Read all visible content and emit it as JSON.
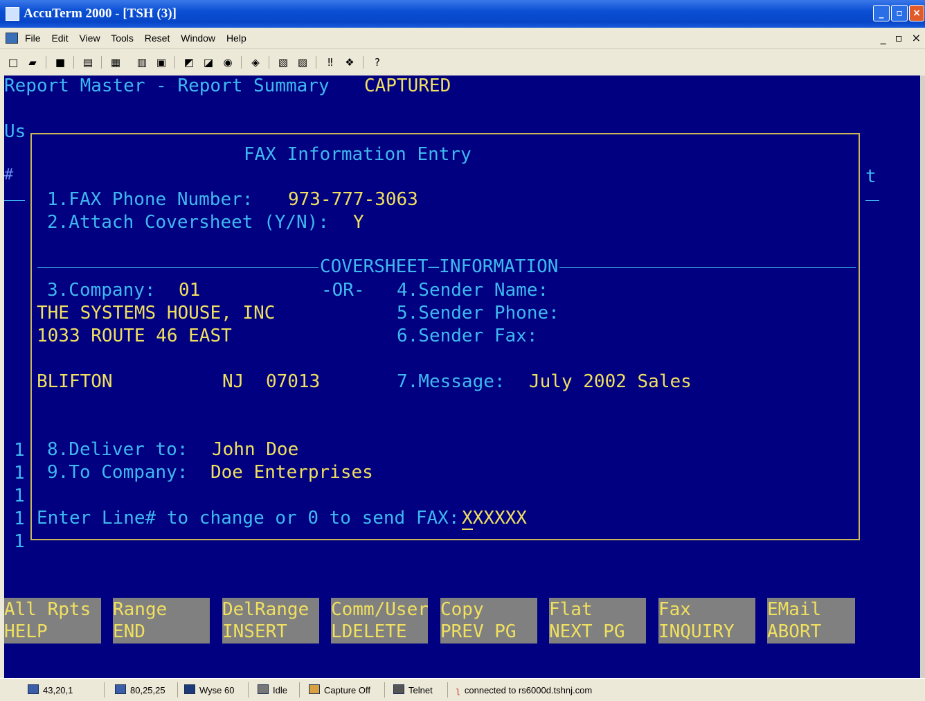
{
  "window": {
    "title": "AccuTerm 2000 - [TSH (3)]"
  },
  "menu": [
    "File",
    "Edit",
    "View",
    "Tools",
    "Reset",
    "Window",
    "Help"
  ],
  "screen": {
    "header": "Report Master - Report Summary",
    "header_status": "CAPTURED",
    "behind_us": "Us",
    "behind_hash": "#",
    "behind_t": "t",
    "left_digits": [
      "1",
      "1",
      "1",
      "1",
      "1"
    ]
  },
  "dialog": {
    "title": "FAX Information Entry",
    "fax_label": "1.FAX Phone Number:",
    "fax_value": "973-777-3063",
    "attach_label": "2.Attach Coversheet (Y/N):",
    "attach_value": "Y",
    "section_title": "COVERSHEET—INFORMATION",
    "company_label": "3.Company:",
    "company_value": "01",
    "or_text": "-OR-",
    "company_name": "THE SYSTEMS HOUSE, INC",
    "address": "1033 ROUTE 46 EAST",
    "city": "BLIFTON",
    "state": "NJ",
    "zip": "07013",
    "sender_name_label": "4.Sender Name:",
    "sender_phone_label": "5.Sender Phone:",
    "sender_fax_label": "6.Sender Fax:",
    "message_label": "7.Message:",
    "message_value": "July 2002 Sales",
    "deliver_label": "8.Deliver to:",
    "deliver_value": "John Doe",
    "to_company_label": "9.To Company:",
    "to_company_value": "Doe Enterprises",
    "prompt": "Enter Line# to change or 0 to send FAX:",
    "prompt_input": "XXXXXX"
  },
  "function_keys": [
    {
      "top": "All Rpts",
      "bottom": "HELP"
    },
    {
      "top": "Range",
      "bottom": "END"
    },
    {
      "top": "DelRange",
      "bottom": "INSERT"
    },
    {
      "top": "Comm/User",
      "bottom": "LDELETE"
    },
    {
      "top": "Copy",
      "bottom": "PREV PG"
    },
    {
      "top": "Flat",
      "bottom": "NEXT PG"
    },
    {
      "top": "Fax",
      "bottom": "INQUIRY"
    },
    {
      "top": "EMail",
      "bottom": "ABORT"
    }
  ],
  "status": {
    "cursor_pos": "43,20,1",
    "screen_size": "80,25,25",
    "terminal_type": "Wyse 60",
    "print_state": "Idle",
    "capture_state": "Capture Off",
    "protocol": "Telnet",
    "connection": "connected to rs6000d.tshnj.com"
  },
  "colors": {
    "terminal_bg": "#000080",
    "label_cyan": "#3fb8f0",
    "value_yellow": "#f0e060",
    "fkey_bg": "#808080"
  }
}
